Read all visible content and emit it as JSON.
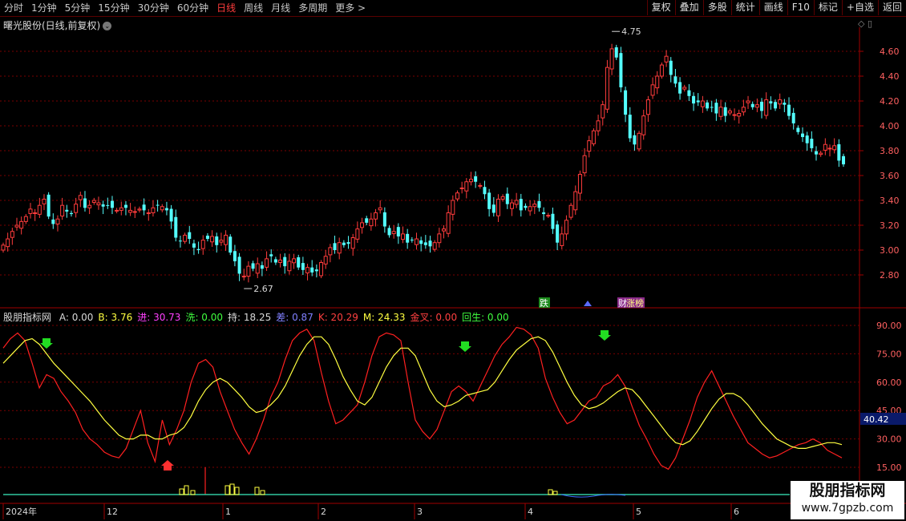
{
  "toolbar": {
    "timeframes": [
      "分时",
      "1分钟",
      "5分钟",
      "15分钟",
      "30分钟",
      "60分钟",
      "日线",
      "周线",
      "月线",
      "多周期",
      "更多 >"
    ],
    "active_index": 6,
    "buttons": [
      "复权",
      "叠加",
      "多股",
      "统计",
      "画线",
      "F10",
      "标记",
      "+自选",
      "返回"
    ]
  },
  "main_chart": {
    "title": "曙光股份(日线,前复权)",
    "price_ticks": [
      "4.60",
      "4.40",
      "4.20",
      "4.00",
      "3.80",
      "3.60",
      "3.40",
      "3.20",
      "3.00",
      "2.80"
    ],
    "high_label": "4.75",
    "low_label": "2.67",
    "markers": {
      "die": "跌",
      "zhangbang": "涨榜",
      "pre": "财"
    }
  },
  "indicator": {
    "name": "股朋指标网",
    "items": [
      {
        "label": "A: 0.00",
        "color": "#d8d8d8"
      },
      {
        "label": "B: 3.76",
        "color": "#ffff40"
      },
      {
        "label": "进: 30.73",
        "color": "#ff40ff"
      },
      {
        "label": "洗: 0.00",
        "color": "#40ff40"
      },
      {
        "label": "持: 18.25",
        "color": "#d8d8d8"
      },
      {
        "label": "差: 0.87",
        "color": "#8080ff"
      },
      {
        "label": "K: 20.29",
        "color": "#ff4040"
      },
      {
        "label": "M: 24.33",
        "color": "#ffff40"
      },
      {
        "label": "金叉: 0.00",
        "color": "#ff4040"
      },
      {
        "label": "回生: 0.00",
        "color": "#40ff40"
      }
    ],
    "ticks": [
      "90.00",
      "75.00",
      "60.00",
      "45.00",
      "30.00",
      "15.00"
    ],
    "current_value": "40.42"
  },
  "date_axis": [
    "2024年",
    "12",
    "1",
    "2",
    "3",
    "4",
    "5",
    "6"
  ],
  "watermark": {
    "title": "股朋指标网",
    "url": "www.7gpzb.com"
  },
  "colors": {
    "up": "#ff3c3c",
    "down": "#54ffff",
    "k_line": "#ff2020",
    "m_line": "#ffff40",
    "grid": "#7a0000",
    "axis": "#a00000"
  },
  "chart_data": [
    {
      "type": "candlestick",
      "title": "曙光股份(日线,前复权)",
      "ylim": [
        2.67,
        4.75
      ],
      "y_ticks": [
        2.8,
        3.0,
        3.2,
        3.4,
        3.6,
        3.8,
        4.0,
        4.2,
        4.4,
        4.6
      ],
      "annotations": [
        {
          "text": "4.75",
          "type": "high"
        },
        {
          "text": "2.67",
          "type": "low"
        }
      ],
      "x_labels": [
        "2024年",
        "12",
        "1",
        "2",
        "3",
        "4",
        "5",
        "6"
      ],
      "close": [
        3.04,
        3.09,
        3.15,
        3.2,
        3.23,
        3.27,
        3.33,
        3.3,
        3.36,
        3.41,
        3.27,
        3.21,
        3.25,
        3.36,
        3.31,
        3.29,
        3.37,
        3.44,
        3.34,
        3.36,
        3.4,
        3.38,
        3.35,
        3.36,
        3.34,
        3.32,
        3.34,
        3.34,
        3.32,
        3.31,
        3.33,
        3.32,
        3.3,
        3.34,
        3.36,
        3.35,
        3.32,
        3.23,
        3.1,
        3.07,
        3.12,
        3.09,
        3.02,
        3.0,
        3.08,
        3.09,
        3.11,
        3.04,
        3.08,
        3.12,
        2.98,
        2.91,
        2.81,
        2.79,
        2.87,
        2.85,
        2.89,
        2.85,
        2.93,
        2.95,
        2.9,
        2.92,
        2.87,
        2.91,
        2.93,
        2.86,
        2.84,
        2.86,
        2.82,
        2.83,
        2.9,
        2.95,
        3.02,
        3.0,
        3.06,
        3.04,
        3.05,
        3.1,
        3.17,
        3.22,
        3.22,
        3.25,
        3.3,
        3.34,
        3.19,
        3.12,
        3.15,
        3.11,
        3.13,
        3.06,
        3.08,
        3.09,
        3.05,
        3.04,
        3.03,
        3.06,
        3.13,
        3.17,
        3.3,
        3.4,
        3.46,
        3.5,
        3.55,
        3.57,
        3.55,
        3.52,
        3.45,
        3.33,
        3.3,
        3.41,
        3.43,
        3.37,
        3.38,
        3.4,
        3.32,
        3.34,
        3.35,
        3.37,
        3.34,
        3.29,
        3.28,
        3.17,
        3.06,
        3.13,
        3.24,
        3.36,
        3.47,
        3.61,
        3.76,
        3.88,
        3.96,
        4.04,
        4.17,
        4.47,
        4.62,
        4.55,
        4.31,
        4.09,
        3.9,
        3.85,
        3.94,
        4.08,
        4.21,
        4.33,
        4.4,
        4.49,
        4.56,
        4.41,
        4.34,
        4.26,
        4.31,
        4.24,
        4.18,
        4.19,
        4.2,
        4.14,
        4.15,
        4.1,
        4.15,
        4.08,
        4.12,
        4.09,
        4.1,
        4.15,
        4.2,
        4.15,
        4.17,
        4.12,
        4.21,
        4.18,
        4.14,
        4.21,
        4.17,
        4.08,
        4.02,
        3.95,
        3.91,
        3.86,
        3.82,
        3.77,
        3.78,
        3.85,
        3.82,
        3.84,
        3.72,
        3.69
      ]
    },
    {
      "type": "line",
      "name": "股朋指标网",
      "ylim": [
        10,
        92
      ],
      "y_ticks": [
        15,
        30,
        45,
        60,
        75,
        90
      ],
      "series": [
        {
          "name": "K",
          "values": [
            78,
            83,
            86,
            82,
            70,
            57,
            64,
            62,
            55,
            50,
            44,
            35,
            30,
            27,
            23,
            21,
            20,
            25,
            35,
            45,
            28,
            18,
            40,
            27,
            35,
            45,
            60,
            70,
            72,
            68,
            55,
            45,
            35,
            28,
            22,
            30,
            40,
            52,
            60,
            72,
            82,
            86,
            88,
            82,
            65,
            50,
            38,
            40,
            44,
            48,
            60,
            74,
            84,
            86,
            85,
            82,
            60,
            40,
            34,
            30,
            35,
            45,
            55,
            58,
            55,
            50,
            58,
            66,
            74,
            80,
            84,
            89,
            88,
            85,
            78,
            62,
            52,
            44,
            38,
            40,
            45,
            50,
            52,
            58,
            60,
            64,
            58,
            47,
            37,
            30,
            22,
            16,
            14,
            20,
            30,
            40,
            52,
            60,
            66,
            58,
            50,
            42,
            35,
            28,
            25,
            22,
            20,
            21,
            23,
            25,
            27,
            28,
            30,
            28,
            24,
            22,
            20
          ]
        },
        {
          "name": "M",
          "values": [
            70,
            74,
            78,
            82,
            83,
            80,
            75,
            70,
            66,
            62,
            58,
            54,
            50,
            45,
            40,
            36,
            32,
            30,
            30,
            32,
            32,
            30,
            30,
            32,
            33,
            36,
            42,
            50,
            56,
            60,
            62,
            60,
            56,
            52,
            47,
            44,
            45,
            48,
            52,
            58,
            66,
            74,
            80,
            84,
            84,
            80,
            72,
            63,
            56,
            50,
            48,
            52,
            60,
            68,
            74,
            78,
            78,
            74,
            65,
            56,
            50,
            47,
            48,
            50,
            53,
            54,
            55,
            56,
            60,
            66,
            72,
            77,
            80,
            83,
            84,
            82,
            76,
            68,
            60,
            53,
            48,
            46,
            47,
            49,
            52,
            55,
            57,
            56,
            52,
            47,
            42,
            37,
            32,
            28,
            27,
            29,
            34,
            40,
            46,
            51,
            54,
            54,
            52,
            48,
            43,
            38,
            34,
            30,
            28,
            26,
            25,
            25,
            26,
            27,
            28,
            28,
            27
          ]
        }
      ]
    }
  ]
}
